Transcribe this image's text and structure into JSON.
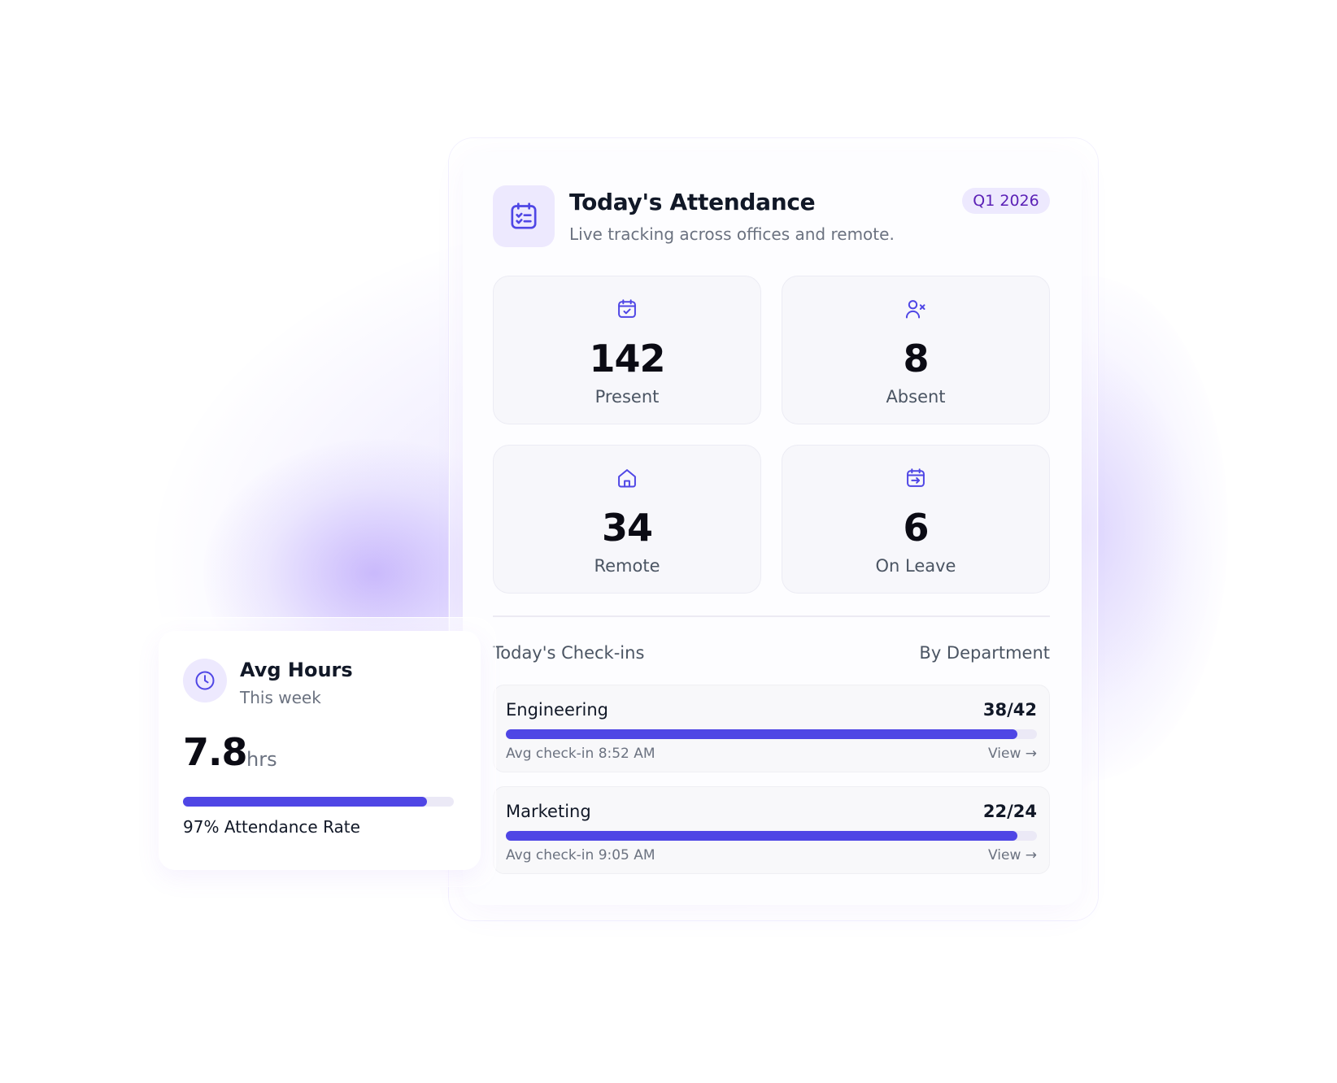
{
  "colors": {
    "accent": "#4f46e5",
    "accent_soft": "#ede9fe",
    "badge_text": "#5b21b6",
    "icon_stroke": "#4f46e5"
  },
  "header": {
    "icon": "calendar-checklist-icon",
    "title": "Today's Attendance",
    "subtitle": "Live tracking across offices and remote.",
    "period_badge": "Q1 2026"
  },
  "stats": [
    {
      "icon": "calendar-check-icon",
      "value": "142",
      "label": "Present"
    },
    {
      "icon": "user-x-icon",
      "value": "8",
      "label": "Absent"
    },
    {
      "icon": "home-icon",
      "value": "34",
      "label": "Remote"
    },
    {
      "icon": "calendar-exit-icon",
      "value": "6",
      "label": "On Leave"
    }
  ],
  "checkins": {
    "title": "Today's Check-ins",
    "grouping": "By Department",
    "departments": [
      {
        "name": "Engineering",
        "count": "38/42",
        "progress": 0.963,
        "avg_checkin": "Avg check-in 8:52 AM",
        "view_label": "View →"
      },
      {
        "name": "Marketing",
        "count": "22/24",
        "progress": 0.963,
        "avg_checkin": "Avg check-in 9:05 AM",
        "view_label": "View →"
      }
    ]
  },
  "avg_hours": {
    "icon": "clock-icon",
    "title": "Avg Hours",
    "subtitle": "This week",
    "value": "7.8",
    "unit": "hrs",
    "rate_progress": 0.9,
    "rate_label": "97% Attendance Rate"
  }
}
